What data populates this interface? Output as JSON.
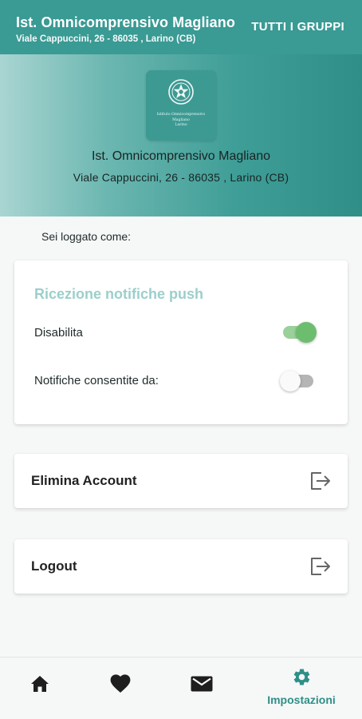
{
  "appbar": {
    "title": "Ist. Omnicomprensivo Magliano",
    "subtitle": "Viale Cappuccini, 26 - 86035 , Larino (CB)",
    "groups_button": "TUTTI I GRUPPI"
  },
  "hero": {
    "logo_lines": [
      "Istituto Omnicomprensivo",
      "Magliano",
      "Larino"
    ],
    "name": "Ist. Omnicomprensivo Magliano",
    "address": "Viale Cappuccini, 26 - 86035 , Larino (CB)"
  },
  "logged_as": "Sei loggato come:",
  "push": {
    "heading": "Ricezione notifiche push",
    "disabled_label": "Disabilita",
    "disabled_on": true,
    "allowed_label": "Notifiche consentite da:",
    "allowed_on": false
  },
  "actions": {
    "delete_account": "Elimina Account",
    "logout": "Logout"
  },
  "bottom_nav": {
    "items": [
      {
        "icon": "home-icon"
      },
      {
        "icon": "heart-icon"
      },
      {
        "icon": "mail-icon"
      },
      {
        "icon": "gear-icon",
        "label": "Impostazioni",
        "active": true
      }
    ]
  },
  "colors": {
    "primary": "#3a9a94",
    "accent_text": "#2f8f88",
    "push_heading": "#9ccfcb",
    "toggle_on": "#6dbd6f"
  }
}
